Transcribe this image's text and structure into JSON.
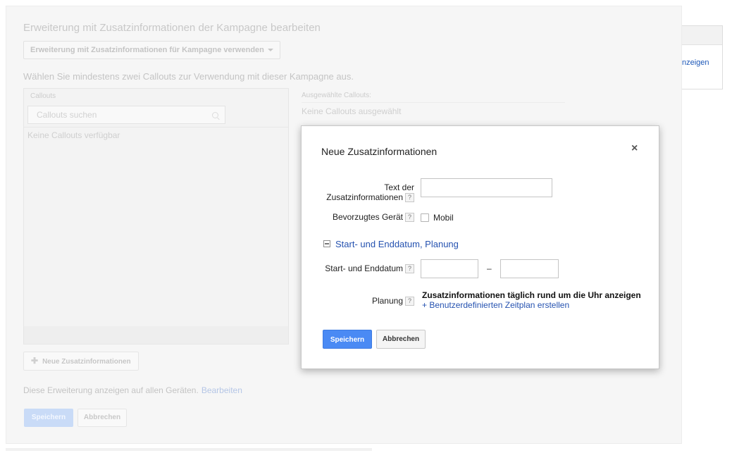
{
  "background": {
    "title": "Erweiterung mit Zusatzinformationen der Kampagne bearbeiten",
    "dropdown_label": "Erweiterung mit Zusatzinformationen für Kampagne verwenden",
    "instruction": "Wählen Sie mindestens zwei Callouts zur Verwendung mit dieser Kampagne aus.",
    "callouts": {
      "header": "Callouts",
      "search_placeholder": "Callouts suchen",
      "empty_text": "Keine Callouts verfügbar"
    },
    "selected": {
      "header": "Ausgewählte Callouts:",
      "empty_text": "Keine Callouts ausgewählt"
    },
    "new_button_label": "Neue Zusatzinformationen",
    "devices_text": "Diese Erweiterung anzeigen auf allen Geräten.",
    "devices_edit_link": "Bearbeiten",
    "save_label": "Speichern",
    "cancel_label": "Abbrechen",
    "right_card_link": "nzeigen"
  },
  "modal": {
    "title": "Neue Zusatzinformationen",
    "close_icon": "×",
    "text_label_line1": "Text der",
    "text_label_line2": "Zusatzinformationen",
    "text_value": "",
    "device_label": "Bevorzugtes Gerät",
    "device_option": "Mobil",
    "device_checked": false,
    "section_label": "Start- und Enddatum, Planung",
    "dates_label": "Start- und Enddatum",
    "date_separator": "–",
    "start_date_value": "",
    "end_date_value": "",
    "planning_label": "Planung",
    "planning_text": "Zusatzinformationen täglich rund um die Uhr anzeigen",
    "planning_link": "+ Benutzerdefinierten Zeitplan erstellen",
    "help_glyph": "?",
    "save_label": "Speichern",
    "cancel_label": "Abbrechen"
  },
  "colors": {
    "primary_button": "#4a8af4",
    "link": "#2552b0"
  }
}
